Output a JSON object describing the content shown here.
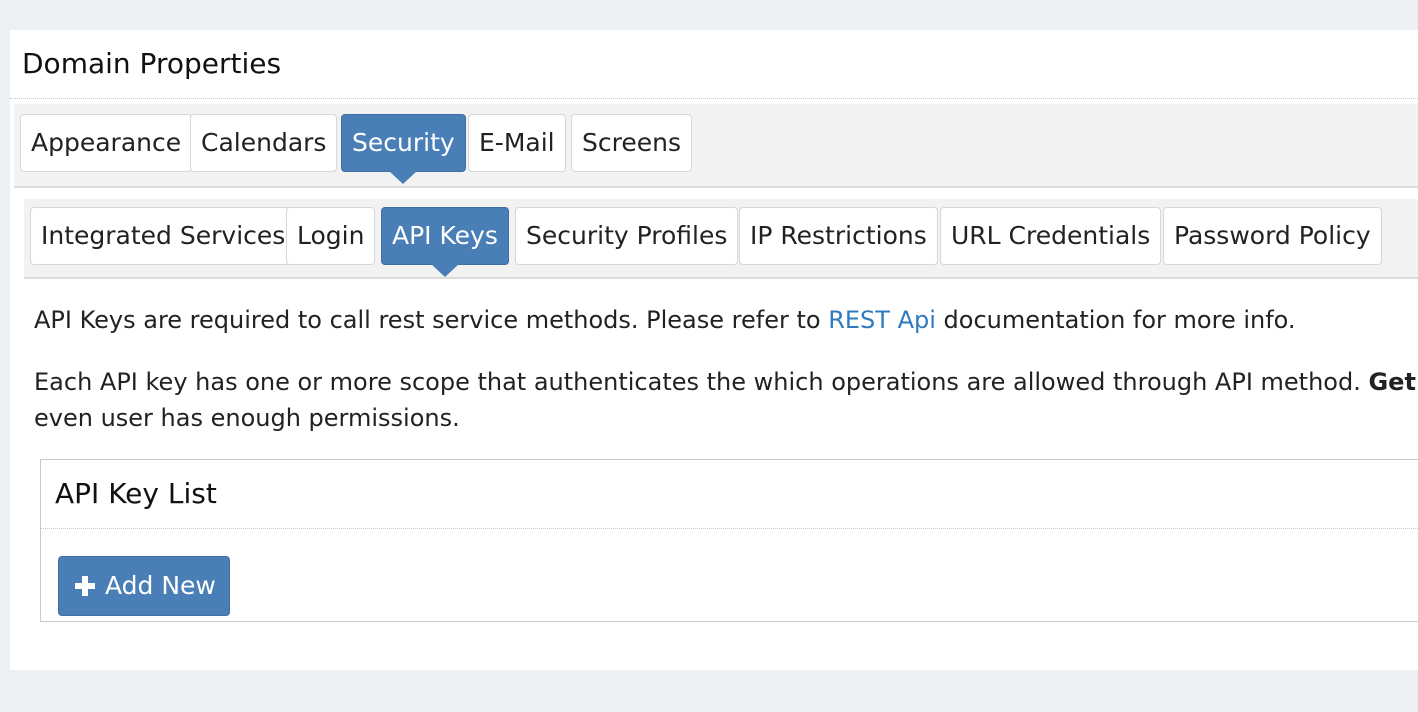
{
  "panel": {
    "title": "Domain Properties"
  },
  "main_tabs": {
    "appearance": "Appearance",
    "calendars": "Calendars",
    "security": "Security",
    "email": "E-Mail",
    "screens": "Screens",
    "active": "Security"
  },
  "sub_tabs": {
    "integrated_services": "Integrated Services",
    "login": "Login",
    "api_keys": "API Keys",
    "security_profiles": "Security Profiles",
    "ip_restrictions": "IP Restrictions",
    "url_credentials": "URL Credentials",
    "password_policy": "Password Policy",
    "active": "API Keys"
  },
  "content": {
    "intro_before": "API Keys are required to call rest service methods. Please refer to ",
    "intro_link": "REST Api",
    "intro_after": " documentation for more info.",
    "scope_text": "Each API key has one or more scope that authenticates the which operations are allowed through API method. ",
    "scope_bold": "Get",
    "scope_line2": "even user has enough permissions."
  },
  "api_key_list": {
    "title": "API Key List",
    "add_button": "Add New"
  },
  "colors": {
    "accent": "#4a7eb6",
    "link": "#2f7bbf",
    "background": "#edf0f3"
  }
}
